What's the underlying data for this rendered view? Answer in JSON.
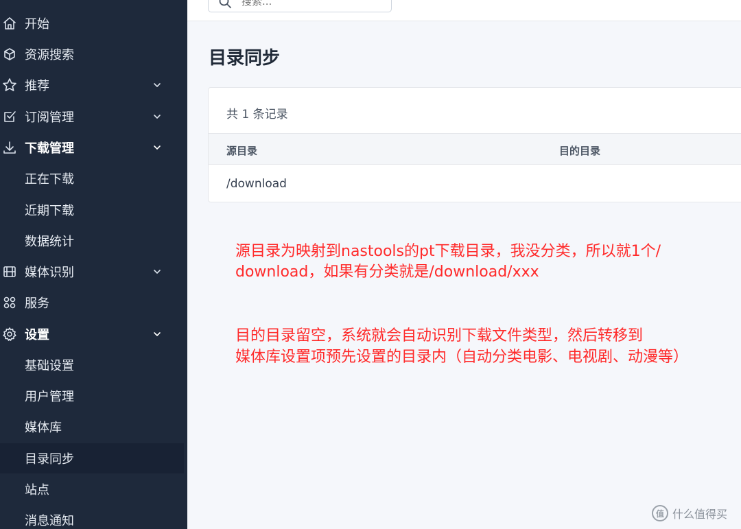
{
  "search": {
    "placeholder": "搜索..."
  },
  "sidebar": {
    "items": [
      {
        "label": "开始",
        "icon": "home-icon"
      },
      {
        "label": "资源搜索",
        "icon": "cube-icon"
      },
      {
        "label": "推荐",
        "icon": "star-icon",
        "chevron": true
      },
      {
        "label": "订阅管理",
        "icon": "checkbox-icon",
        "chevron": true
      },
      {
        "label": "下载管理",
        "icon": "download-icon",
        "chevron": true,
        "expanded": true
      },
      {
        "label": "正在下载"
      },
      {
        "label": "近期下载"
      },
      {
        "label": "数据统计"
      },
      {
        "label": "媒体识别",
        "icon": "film-icon",
        "chevron": true
      },
      {
        "label": "服务",
        "icon": "apps-icon"
      },
      {
        "label": "设置",
        "icon": "gear-icon",
        "chevron": true,
        "expanded": true
      },
      {
        "label": "基础设置"
      },
      {
        "label": "用户管理"
      },
      {
        "label": "媒体库"
      },
      {
        "label": "目录同步",
        "active": true
      },
      {
        "label": "站点"
      },
      {
        "label": "消息通知"
      }
    ]
  },
  "main": {
    "title": "目录同步",
    "record_count": "共 1 条记录",
    "table": {
      "columns": [
        "源目录",
        "目的目录"
      ],
      "rows": [
        [
          "/download",
          ""
        ]
      ]
    }
  },
  "annotations": {
    "line1": "源目录为映射到nastools的pt下载目录，我没分类，所以就1个/",
    "line2": "download，如果有分类就是/download/xxx",
    "line3": "目的目录留空，系统就会自动识别下载文件类型，然后转移到",
    "line4": "媒体库设置项预先设置的目录内（自动分类电影、电视剧、动漫等）"
  },
  "watermark": {
    "text": "什么值得买",
    "logo": "值"
  },
  "colors": {
    "sidebar_bg": "#1e293b",
    "annotation": "#ff2a2a"
  }
}
